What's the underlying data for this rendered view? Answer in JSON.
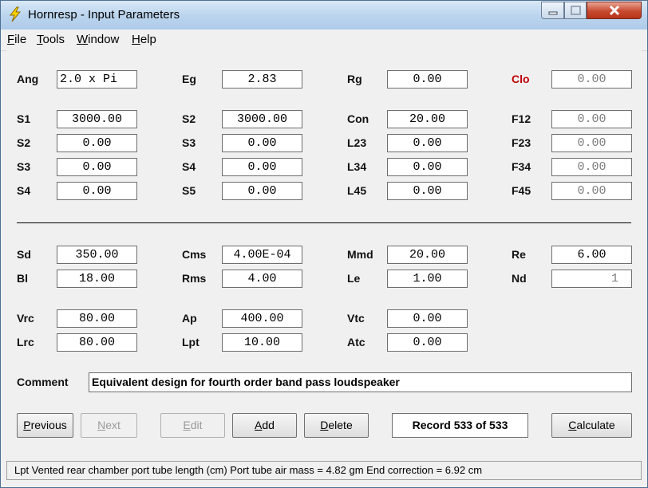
{
  "window": {
    "title": "Hornresp - Input Parameters"
  },
  "menu": [
    {
      "label": "File",
      "accel": "F",
      "rest": "ile"
    },
    {
      "label": "Tools",
      "accel": "T",
      "rest": "ools"
    },
    {
      "label": "Window",
      "accel": "W",
      "rest": "indow"
    },
    {
      "label": "Help",
      "accel": "H",
      "rest": "elp"
    }
  ],
  "params": {
    "ang": {
      "label": "Ang",
      "value": "2.0 x Pi"
    },
    "eg": {
      "label": "Eg",
      "value": "2.83"
    },
    "rg": {
      "label": "Rg",
      "value": "0.00"
    },
    "clo": {
      "label": "Clo",
      "value": "0.00"
    },
    "s1": {
      "label": "S1",
      "value": "3000.00"
    },
    "s2b": {
      "label": "S2",
      "value": "3000.00"
    },
    "con": {
      "label": "Con",
      "value": "20.00"
    },
    "f12": {
      "label": "F12",
      "value": "0.00"
    },
    "s2": {
      "label": "S2",
      "value": "0.00"
    },
    "s3b": {
      "label": "S3",
      "value": "0.00"
    },
    "l23": {
      "label": "L23",
      "value": "0.00"
    },
    "f23": {
      "label": "F23",
      "value": "0.00"
    },
    "s3": {
      "label": "S3",
      "value": "0.00"
    },
    "s4b": {
      "label": "S4",
      "value": "0.00"
    },
    "l34": {
      "label": "L34",
      "value": "0.00"
    },
    "f34": {
      "label": "F34",
      "value": "0.00"
    },
    "s4": {
      "label": "S4",
      "value": "0.00"
    },
    "s5": {
      "label": "S5",
      "value": "0.00"
    },
    "l45": {
      "label": "L45",
      "value": "0.00"
    },
    "f45": {
      "label": "F45",
      "value": "0.00"
    },
    "sd": {
      "label": "Sd",
      "value": "350.00"
    },
    "cms": {
      "label": "Cms",
      "value": "4.00E-04"
    },
    "mmd": {
      "label": "Mmd",
      "value": "20.00"
    },
    "re": {
      "label": "Re",
      "value": "6.00"
    },
    "bl": {
      "label": "Bl",
      "value": "18.00"
    },
    "rms": {
      "label": "Rms",
      "value": "4.00"
    },
    "le": {
      "label": "Le",
      "value": "1.00"
    },
    "nd": {
      "label": "Nd",
      "value": "1"
    },
    "vrc": {
      "label": "Vrc",
      "value": "80.00"
    },
    "ap": {
      "label": "Ap",
      "value": "400.00"
    },
    "vtc": {
      "label": "Vtc",
      "value": "0.00"
    },
    "lrc": {
      "label": "Lrc",
      "value": "80.00"
    },
    "lpt": {
      "label": "Lpt",
      "value": "10.00"
    },
    "atc": {
      "label": "Atc",
      "value": "0.00"
    }
  },
  "comment": {
    "label": "Comment",
    "value": "Equivalent design for fourth order band pass loudspeaker"
  },
  "buttons": {
    "previous": {
      "accel": "P",
      "rest": "revious"
    },
    "next": {
      "accel": "N",
      "rest": "ext"
    },
    "edit": {
      "accel": "E",
      "rest": "dit"
    },
    "add": {
      "accel": "A",
      "rest": "dd"
    },
    "delete": {
      "accel": "D",
      "rest": "elete"
    },
    "calculate": {
      "accel": "C",
      "rest": "alculate"
    }
  },
  "record": "Record 533 of 533",
  "status": "Lpt   Vented rear chamber port tube length  (cm)   Port tube air mass = 4.82 gm   End correction = 6.92 cm",
  "colors": {
    "accent_red": "#c00000",
    "title_gradient_top": "#d9e8f7",
    "close_red": "#c74a30"
  },
  "icons": {
    "app": "lightning-bolt-icon"
  }
}
